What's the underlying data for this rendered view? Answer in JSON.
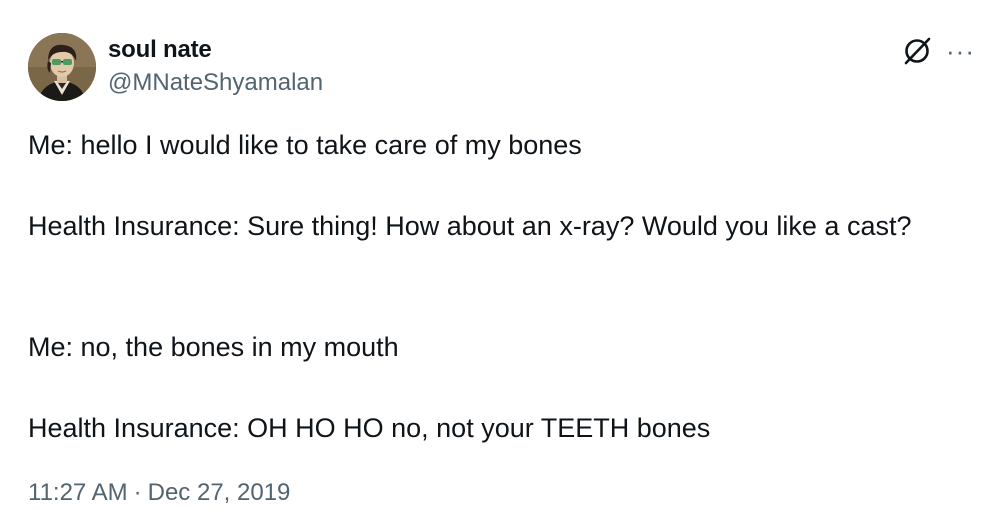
{
  "author": {
    "display_name": "soul nate",
    "handle": "@MNateShyamalan"
  },
  "icons": {
    "grok": "grok-icon",
    "more": "more-icon"
  },
  "tweet": {
    "paragraphs": [
      "Me: hello I would like to take care of my bones",
      "Health Insurance: Sure thing! How about an x-ray? Would you like a cast?",
      "Me: no, the bones in my mouth",
      "Health Insurance: OH HO HO no, not your TEETH bones"
    ],
    "time": "11:27 AM",
    "separator": "·",
    "date": "Dec 27, 2019"
  },
  "colors": {
    "text": "#0f1419",
    "secondary": "#536471",
    "background": "#ffffff"
  }
}
